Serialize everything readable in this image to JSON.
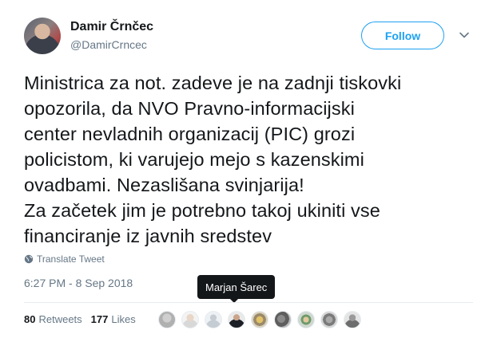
{
  "author": {
    "name": "Damir Črnčec",
    "handle": "@DamirCrncec"
  },
  "actions": {
    "follow_label": "Follow",
    "menu_icon": "chevron-down-icon"
  },
  "tweet": {
    "text": "Ministrica za not. zadeve je na zadnji tiskovki\nopozorila, da NVO Pravno-informacijski\ncenter nevladnih organizacij (PIC) grozi\npolicistom, ki varujejo mejo s kazenskimi\novadbami. Nezaslišana svinjarija!\nZa začetek jim je potrebno takoj ukiniti vse\nfinanciranje iz javnih sredstev",
    "translate_label": "Translate Tweet",
    "translate_icon": "globe-icon",
    "timestamp": "6:27 PM - 8 Sep 2018"
  },
  "tooltip": {
    "text": "Marjan Šarec"
  },
  "stats": {
    "retweets_count": "80",
    "retweets_label": "Retweets",
    "likes_count": "177",
    "likes_label": "Likes"
  },
  "colors": {
    "accent": "#1da1f2",
    "text": "#14171a",
    "muted": "#657786",
    "divider": "#e6ecf0"
  }
}
